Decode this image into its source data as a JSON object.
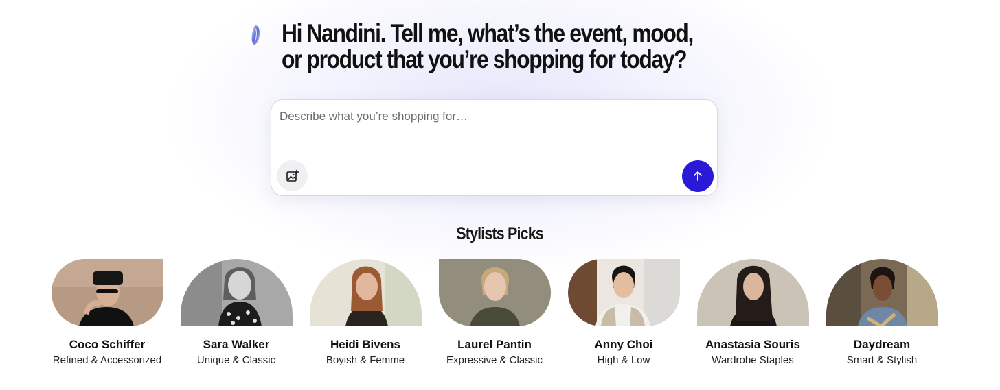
{
  "hero": {
    "headline_line1": "Hi Nandini. Tell me, what’s the event, mood,",
    "headline_line2": "or product that you’re shopping for today?"
  },
  "prompt": {
    "placeholder": "Describe what you’re shopping for…",
    "value": "",
    "image_button_icon": "image-add-icon",
    "send_button_icon": "arrow-up-icon",
    "send_color": "#2a1ad8"
  },
  "stylists_section": {
    "title": "Stylists Picks",
    "items": [
      {
        "name": "Coco Schiffer",
        "description": "Refined & Accessorized"
      },
      {
        "name": "Sara Walker",
        "description": "Unique & Classic"
      },
      {
        "name": "Heidi Bivens",
        "description": "Boyish & Femme"
      },
      {
        "name": "Laurel Pantin",
        "description": "Expressive & Classic"
      },
      {
        "name": "Anny Choi",
        "description": "High & Low"
      },
      {
        "name": "Anastasia Souris",
        "description": "Wardrobe Staples"
      },
      {
        "name": "Daydream",
        "description": "Smart & Stylish"
      }
    ]
  }
}
